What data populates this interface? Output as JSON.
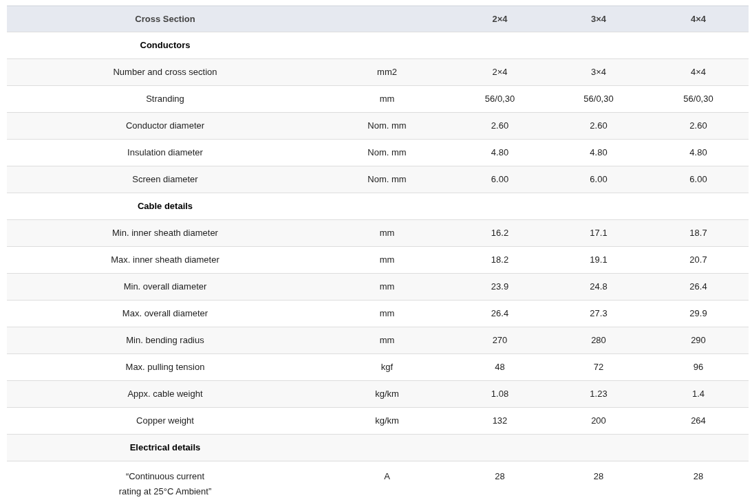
{
  "table": {
    "columns": [
      "Cross Section",
      "",
      "2×4",
      "3×4",
      "4×4"
    ],
    "rows": [
      {
        "kind": "section",
        "label": "Conductors"
      },
      {
        "kind": "data",
        "cells": [
          "Number and cross section",
          "mm2",
          "2×4",
          "3×4",
          "4×4"
        ]
      },
      {
        "kind": "data",
        "cells": [
          "Stranding",
          "mm",
          "56/0,30",
          "56/0,30",
          "56/0,30"
        ]
      },
      {
        "kind": "data",
        "cells": [
          "Conductor diameter",
          "Nom. mm",
          "2.60",
          "2.60",
          "2.60"
        ]
      },
      {
        "kind": "data",
        "cells": [
          "Insulation diameter",
          "Nom. mm",
          "4.80",
          "4.80",
          "4.80"
        ]
      },
      {
        "kind": "data",
        "cells": [
          "Screen diameter",
          "Nom. mm",
          "6.00",
          "6.00",
          "6.00"
        ]
      },
      {
        "kind": "section",
        "label": "Cable details"
      },
      {
        "kind": "data",
        "cells": [
          "Min. inner sheath diameter",
          "mm",
          "16.2",
          "17.1",
          "18.7"
        ]
      },
      {
        "kind": "data",
        "cells": [
          "Max. inner sheath diameter",
          "mm",
          "18.2",
          "19.1",
          "20.7"
        ]
      },
      {
        "kind": "data",
        "cells": [
          "Min. overall diameter",
          "mm",
          "23.9",
          "24.8",
          "26.4"
        ]
      },
      {
        "kind": "data",
        "cells": [
          "Max. overall diameter",
          "mm",
          "26.4",
          "27.3",
          "29.9"
        ]
      },
      {
        "kind": "data",
        "cells": [
          "Min. bending radius",
          "mm",
          "270",
          "280",
          "290"
        ]
      },
      {
        "kind": "data",
        "cells": [
          "Max. pulling tension",
          "kgf",
          "48",
          "72",
          "96"
        ]
      },
      {
        "kind": "data",
        "cells": [
          "Appx. cable weight",
          "kg/km",
          "1.08",
          "1.23",
          "1.4"
        ]
      },
      {
        "kind": "data",
        "cells": [
          "Copper weight",
          "kg/km",
          "132",
          "200",
          "264"
        ]
      },
      {
        "kind": "section",
        "label": "Electrical details"
      },
      {
        "kind": "data",
        "cells": [
          "“Continuous current\nrating at 25°C Ambient”",
          "A",
          "28",
          "28",
          "28"
        ]
      }
    ]
  }
}
